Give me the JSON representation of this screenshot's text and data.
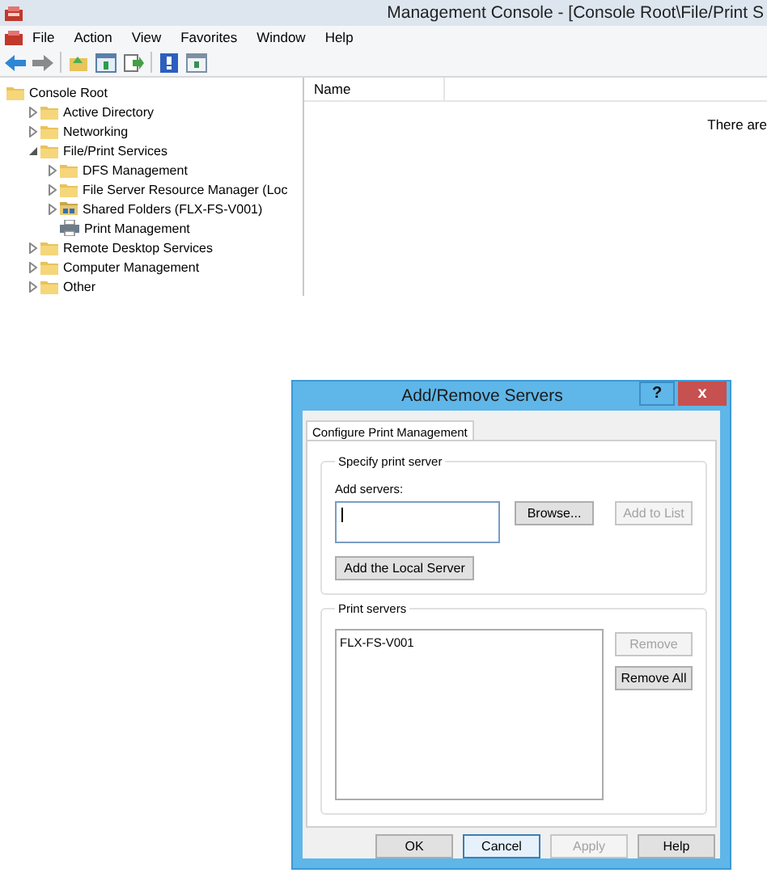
{
  "window": {
    "title": "Management Console - [Console Root\\File/Print S"
  },
  "menu": [
    "File",
    "Action",
    "View",
    "Favorites",
    "Window",
    "Help"
  ],
  "tree": {
    "items": [
      {
        "label": "Console Root",
        "kind": "folder",
        "children": [
          {
            "label": "Active Directory",
            "kind": "folder",
            "expanded": false
          },
          {
            "label": "Networking",
            "kind": "folder",
            "expanded": false
          },
          {
            "label": "File/Print Services",
            "kind": "folder",
            "expanded": true,
            "children": [
              {
                "label": "DFS Management",
                "kind": "folder",
                "expanded": false
              },
              {
                "label": "File Server Resource Manager (Loc",
                "kind": "folder",
                "expanded": false
              },
              {
                "label": "Shared Folders (FLX-FS-V001)",
                "kind": "share",
                "expanded": false
              },
              {
                "label": "Print Management",
                "kind": "printer"
              }
            ]
          },
          {
            "label": "Remote Desktop Services",
            "kind": "folder",
            "expanded": false
          },
          {
            "label": "Computer Management",
            "kind": "folder",
            "expanded": false
          },
          {
            "label": "Other",
            "kind": "folder",
            "expanded": false
          }
        ]
      }
    ]
  },
  "list_pane": {
    "columns": [
      "Name"
    ],
    "message": "There are"
  },
  "dialog": {
    "title": "Add/Remove Servers",
    "help_button": "?",
    "close_button": "x",
    "tabs": [
      {
        "label": "Configure Print Management",
        "selected": true
      }
    ],
    "specify_group": {
      "title": "Specify print server",
      "field_label": "Add servers:",
      "buttons": [
        {
          "label": "Browse...",
          "disabled": false
        },
        {
          "label": "Add to List",
          "disabled": true
        }
      ],
      "local_button": {
        "label": "Add the Local Server",
        "disabled": false
      }
    },
    "servers_group": {
      "title": "Print servers",
      "items": [
        "FLX-FS-V001"
      ],
      "buttons": [
        {
          "label": "Remove",
          "disabled": true
        },
        {
          "label": "Remove All",
          "disabled": false
        }
      ]
    },
    "footer_buttons": [
      {
        "label": "OK",
        "disabled": false,
        "focused": false
      },
      {
        "label": "Cancel",
        "disabled": false,
        "focused": true
      },
      {
        "label": "Apply",
        "disabled": true,
        "focused": false
      },
      {
        "label": "Help",
        "disabled": false,
        "focused": false
      }
    ]
  }
}
